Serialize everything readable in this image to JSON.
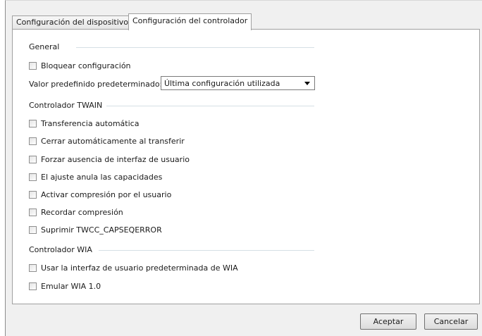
{
  "tabs": {
    "device": "Configuración del dispositivo",
    "driver": "Configuración del controlador"
  },
  "general": {
    "title": "General",
    "lock_settings": "Bloquear configuración",
    "default_label": "Valor predefinido predeterminado:",
    "default_value": "Última configuración utilizada"
  },
  "twain": {
    "title": "Controlador TWAIN",
    "items": [
      "Transferencia automática",
      "Cerrar automáticamente al transferir",
      "Forzar ausencia de interfaz de usuario",
      "El ajuste anula las capacidades",
      "Activar compresión por el usuario",
      "Recordar compresión",
      "Suprimir TWCC_CAPSEQERROR"
    ]
  },
  "wia": {
    "title": "Controlador WIA",
    "items": [
      "Usar la interfaz de usuario predeterminada de WIA",
      "Emular WIA 1.0"
    ]
  },
  "buttons": {
    "ok": "Aceptar",
    "cancel": "Cancelar"
  }
}
